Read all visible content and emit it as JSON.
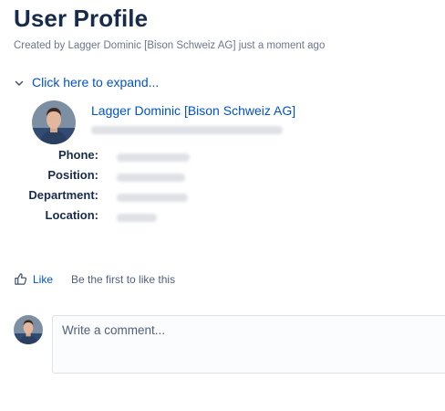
{
  "page": {
    "title": "User Profile",
    "meta": "Created by Lagger Dominic [Bison Schweiz AG] just a moment ago",
    "expand_label": "Click here to expand..."
  },
  "profile": {
    "name": "Lagger Dominic [Bison Schweiz AG]",
    "fields": [
      {
        "label": "Phone:"
      },
      {
        "label": "Position:"
      },
      {
        "label": "Department:"
      },
      {
        "label": "Location:"
      }
    ]
  },
  "social": {
    "like_label": "Like",
    "like_text": "Be the first to like this"
  },
  "comment": {
    "placeholder": "Write a comment..."
  },
  "colors": {
    "link": "#0052cc",
    "title": "#172b4d",
    "meta": "#6b778c"
  }
}
